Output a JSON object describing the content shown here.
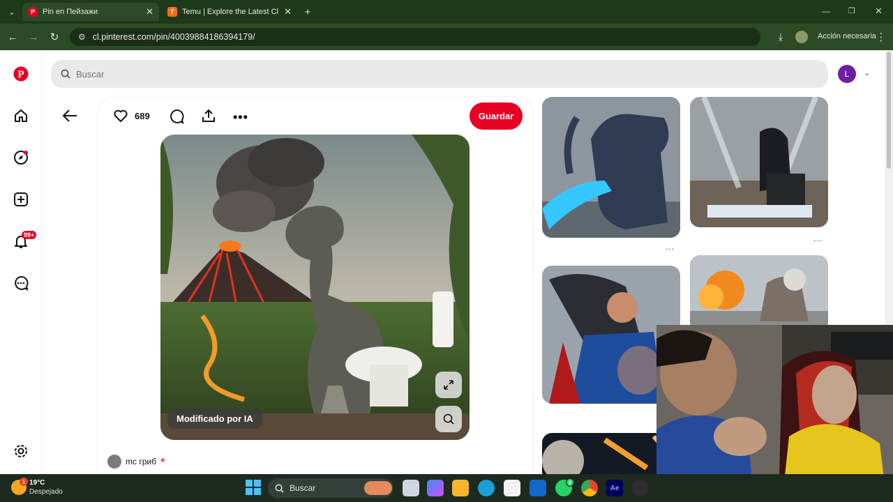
{
  "browser": {
    "tabs": [
      {
        "title": "Pin en Пейзажи",
        "active": true
      },
      {
        "title": "Temu | Explore the Latest Cloth",
        "active": false
      }
    ],
    "new_tab": "+",
    "url": "cl.pinterest.com/pin/40039884186394179/",
    "profile_action": "Acción necesaria"
  },
  "pinterest": {
    "search_placeholder": "Buscar",
    "avatar_letter": "L",
    "notifications_badge": "99+",
    "like_count": "689",
    "save_label": "Guardar",
    "ai_badge": "Modificado por IA",
    "author": "mc гриб",
    "more_dots": "..."
  },
  "taskbar": {
    "temperature": "19°C",
    "weather": "Despejado",
    "weather_badge": "1",
    "search_placeholder": "Buscar",
    "whatsapp_badge": "8",
    "ae_label": "Ae"
  },
  "colors": {
    "brand": "#e60023",
    "chrome_frame": "#1f3a1a",
    "chrome_toolbar": "#2d4a26"
  }
}
